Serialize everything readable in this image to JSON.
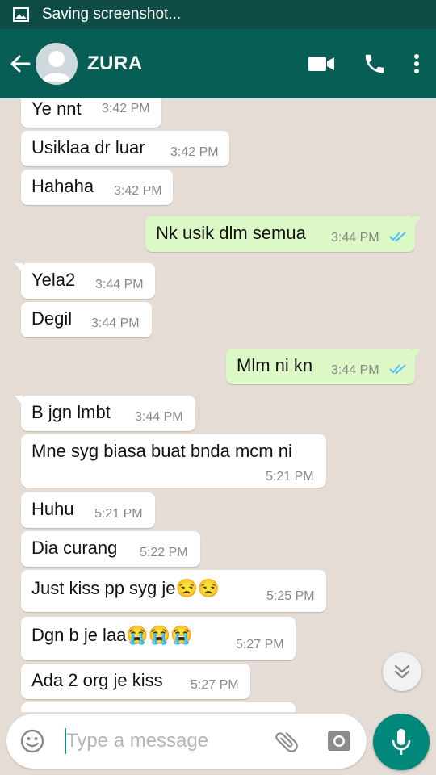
{
  "status_bar": {
    "text": "Saving screenshot..."
  },
  "header": {
    "contact_name": "ZURA"
  },
  "messages": [
    {
      "text": "Ye nnt",
      "time": "3:42 PM",
      "dir": "in"
    },
    {
      "text": "Usiklaa dr luar",
      "time": "3:42 PM",
      "dir": "in"
    },
    {
      "text": "Hahaha",
      "time": "3:42 PM",
      "dir": "in"
    },
    {
      "text": "Nk usik dlm semua",
      "time": "3:44 PM",
      "dir": "out",
      "read": true
    },
    {
      "text": "Yela2",
      "time": "3:44 PM",
      "dir": "in"
    },
    {
      "text": "Degil",
      "time": "3:44 PM",
      "dir": "in"
    },
    {
      "text": "Mlm ni kn",
      "time": "3:44 PM",
      "dir": "out",
      "read": true
    },
    {
      "text": "B jgn lmbt",
      "time": "3:44 PM",
      "dir": "in"
    },
    {
      "text": "Mne syg biasa buat bnda mcm ni",
      "time": "5:21 PM",
      "dir": "in"
    },
    {
      "text": "Huhu",
      "time": "5:21 PM",
      "dir": "in"
    },
    {
      "text": "Dia curang",
      "time": "5:22 PM",
      "dir": "in"
    },
    {
      "text": "Just kiss pp syg je😒😒",
      "time": "5:25 PM",
      "dir": "in"
    },
    {
      "text": "Dgn b je laa😭😭😭",
      "time": "5:27 PM",
      "dir": "in"
    },
    {
      "text": "Ada 2 org je kiss",
      "time": "5:27 PM",
      "dir": "in"
    }
  ],
  "composer": {
    "placeholder": "Type a message"
  },
  "colors": {
    "header": "#075e54",
    "status_bar": "#0f4c45",
    "outgoing": "#dcf8c6",
    "read_ticks": "#4fc3f7",
    "mic": "#00897b"
  },
  "icons": [
    "image-icon",
    "back-arrow-icon",
    "avatar-icon",
    "video-call-icon",
    "phone-icon",
    "more-vert-icon",
    "double-check-icon",
    "chevron-down-icon",
    "emoji-icon",
    "attach-icon",
    "camera-icon",
    "mic-icon"
  ]
}
